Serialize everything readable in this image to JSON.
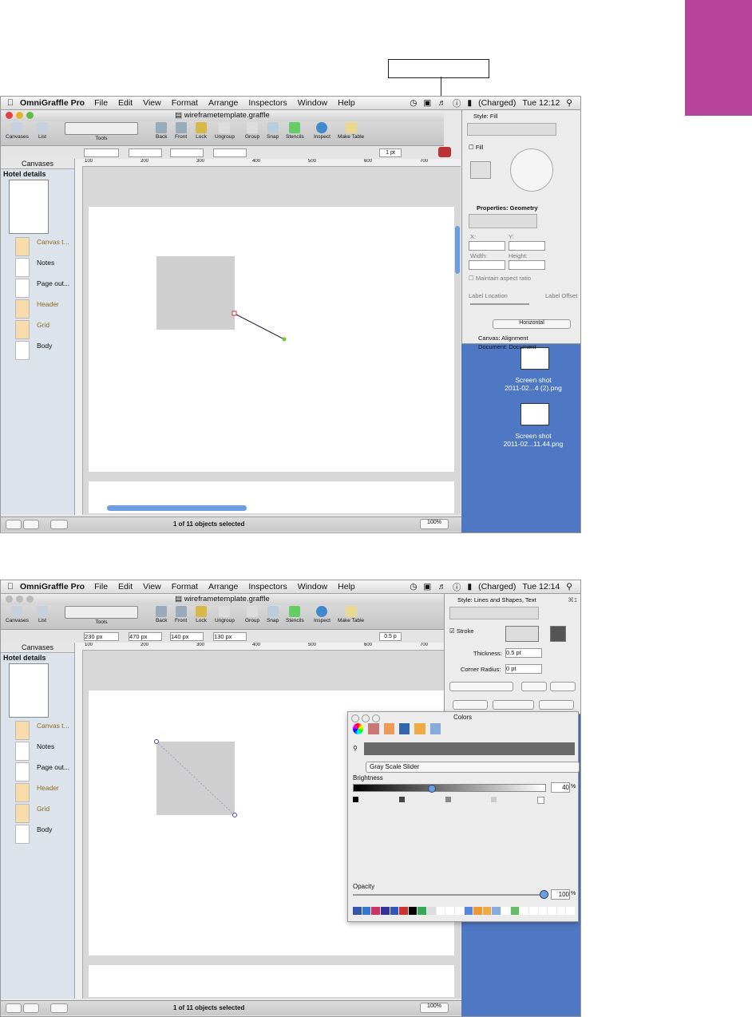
{
  "colors": {
    "accent": "#b5449a",
    "desktop": "#4f78c4",
    "canvas_bg": "#d8d8d8",
    "shape_fill": "#cfcfcf",
    "sidebar": "#dde3ea"
  },
  "shot1": {
    "menubar": {
      "app": "OmniGraffle Pro",
      "items": [
        "File",
        "Edit",
        "View",
        "Format",
        "Arrange",
        "Inspectors",
        "Window",
        "Help"
      ],
      "battery": "(Charged)",
      "clock": "Tue 12:12"
    },
    "window_title": "wireframetemplate.graffle",
    "toolbar": {
      "canvases": "Canvases",
      "list": "List",
      "tools": "Tools",
      "buttons": [
        "Back",
        "Front",
        "Lock",
        "Ungroup",
        "Group",
        "Snap",
        "Stencils",
        "Inspect",
        "Make Table"
      ]
    },
    "stylebar": {
      "line_width": "1 pt"
    },
    "sidebar": {
      "header": "Canvases",
      "title": "Hotel details",
      "layers": [
        "Canvas t...",
        "Notes",
        "Page out...",
        "Header",
        "Grid",
        "Body"
      ]
    },
    "rulers": [
      "100",
      "200",
      "300",
      "400",
      "500",
      "600",
      "700"
    ],
    "status": {
      "selection": "1 of 11 objects selected",
      "zoom": "100%"
    },
    "inspector": {
      "style_title": "Style: Fill",
      "fill_label": "Fill",
      "properties_title": "Properties: Geometry",
      "x": "X:",
      "y": "Y:",
      "width": "Width:",
      "height": "Height:",
      "aspect": "Maintain aspect ratio",
      "label_location": "Label Location",
      "label_offset": "Label Offset",
      "orientation": "Horizontal",
      "canvas_alignment": "Canvas: Alignment",
      "document": "Document: Document"
    },
    "desktop_files": [
      "Screen shot\n2011-02...4 (2).png",
      "Screen shot\n2011-02...11.44.png"
    ]
  },
  "shot2": {
    "menubar": {
      "app": "OmniGraffle Pro",
      "items": [
        "File",
        "Edit",
        "View",
        "Format",
        "Arrange",
        "Inspectors",
        "Window",
        "Help"
      ],
      "battery": "(Charged)",
      "clock": "Tue 12:14"
    },
    "window_title": "wireframetemplate.graffle",
    "stylebar": {
      "x": "230 px",
      "y": "470 px",
      "w": "140 px",
      "h": "130 px",
      "line_width": "0.5 p"
    },
    "inspector": {
      "style_title": "Style: Lines and Shapes, Text",
      "shortcut": "⌘1",
      "stroke": "Stroke",
      "thickness_label": "Thickness:",
      "thickness": "0.5 pt",
      "corner_label": "Corner Radius:",
      "corner": "0 pt"
    },
    "colors": {
      "title": "Colors",
      "mode": "Gray Scale Slider",
      "brightness_label": "Brightness",
      "brightness": "40",
      "opacity_label": "Opacity",
      "opacity": "100",
      "pct": "%",
      "brightness_level": 0.4,
      "opacity_level": 1.0
    },
    "status": {
      "selection": "1 of 11 objects selected",
      "zoom": "100%"
    }
  }
}
